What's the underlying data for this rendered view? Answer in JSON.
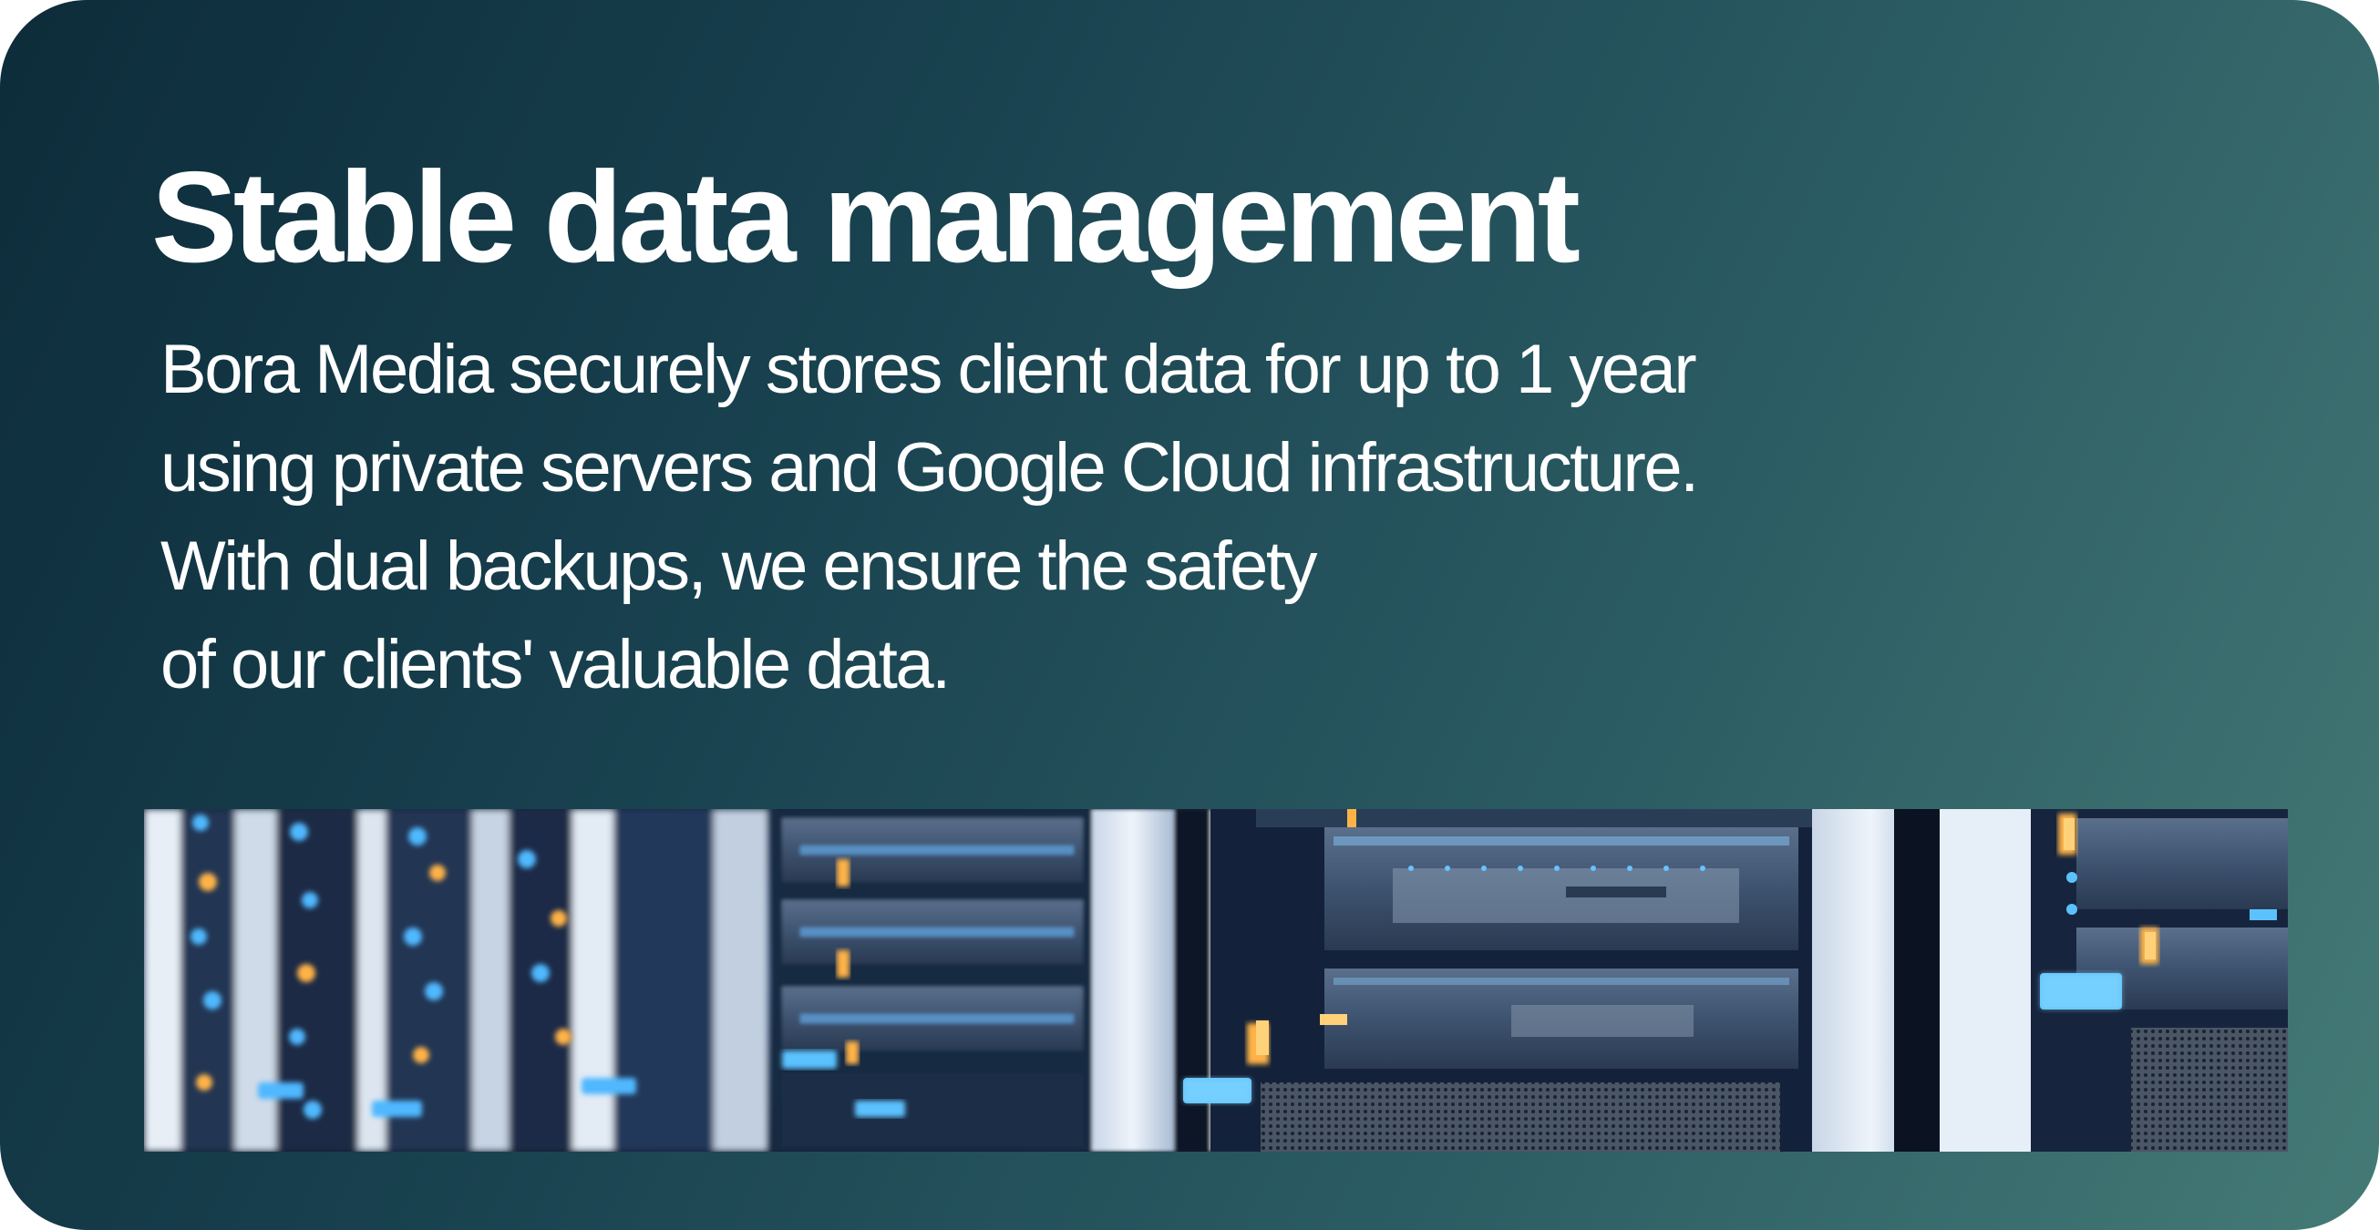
{
  "card": {
    "title": "Stable data management",
    "body_lines": [
      "Bora Media securely stores client data for up to 1 year",
      "using private servers and Google Cloud infrastructure.",
      "With dual backups, we ensure the safety",
      "of our clients' valuable data."
    ]
  },
  "image": {
    "subject": "server racks with blue status lights",
    "icon": "server-rack-photo"
  },
  "colors": {
    "gradient_start": "#0d2c3a",
    "gradient_end": "#447a76",
    "text": "#ffffff",
    "led_blue": "#4fb8ff",
    "led_amber": "#ffb347"
  }
}
